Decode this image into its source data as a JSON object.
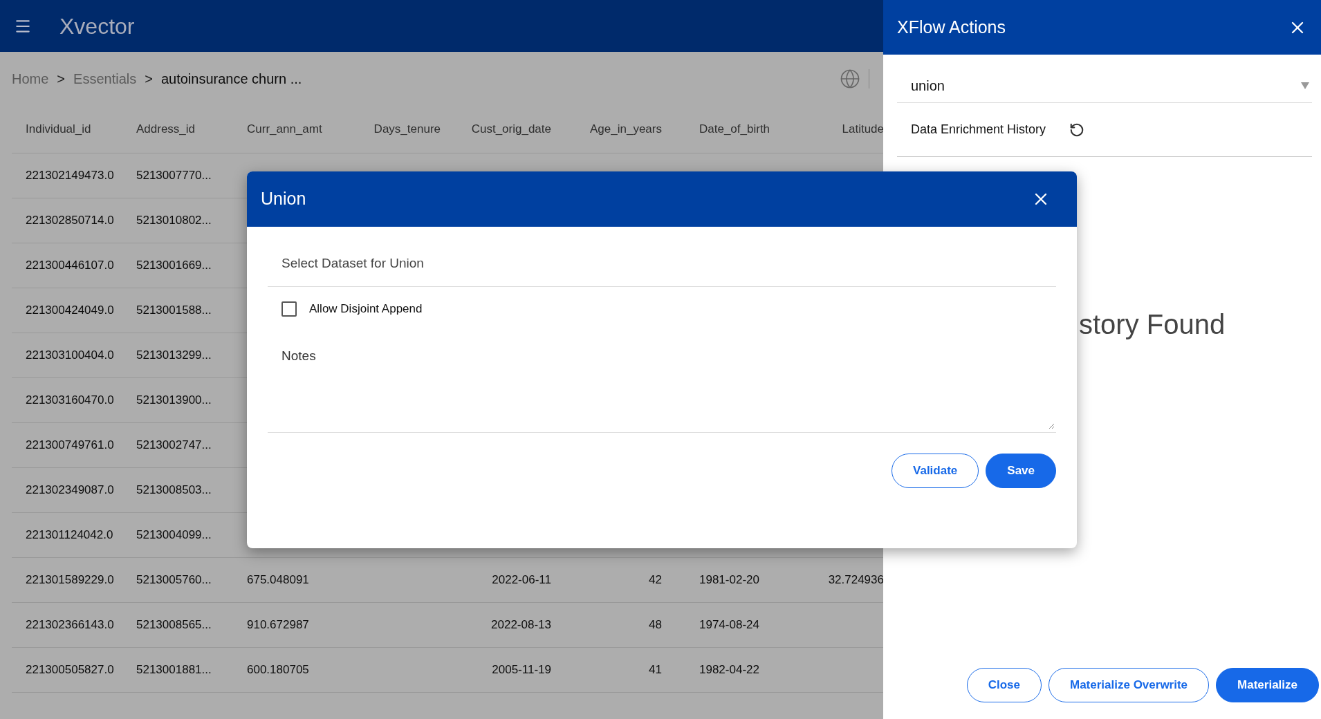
{
  "app": {
    "logo": "Xvector"
  },
  "breadcrumb": [
    {
      "label": "Home",
      "current": false
    },
    {
      "label": "Essentials",
      "current": false
    },
    {
      "label": "autoinsurance churn ...",
      "current": true
    }
  ],
  "breadcrumb_separator": ">",
  "table": {
    "columns": [
      "Individual_id",
      "Address_id",
      "Curr_ann_amt",
      "Days_tenure",
      "Cust_orig_date",
      "Age_in_years",
      "Date_of_birth",
      "Latitude"
    ],
    "rows": [
      {
        "individual_id": "221302149473.0",
        "address_id": "5213007770..."
      },
      {
        "individual_id": "221302850714.0",
        "address_id": "5213010802..."
      },
      {
        "individual_id": "221300446107.0",
        "address_id": "5213001669..."
      },
      {
        "individual_id": "221300424049.0",
        "address_id": "5213001588..."
      },
      {
        "individual_id": "221303100404.0",
        "address_id": "5213013299..."
      },
      {
        "individual_id": "221303160470.0",
        "address_id": "5213013900..."
      },
      {
        "individual_id": "221300749761.0",
        "address_id": "5213002747..."
      },
      {
        "individual_id": "221302349087.0",
        "address_id": "5213008503..."
      },
      {
        "individual_id": "221301124042.0",
        "address_id": "5213004099..."
      },
      {
        "individual_id": "221301589229.0",
        "address_id": "5213005760...",
        "curr_ann_amt": "675.048091",
        "cust_orig_date": "2022-06-11",
        "age_in_years": "42",
        "date_of_birth": "1981-02-20",
        "latitude": "32.724936"
      },
      {
        "individual_id": "221302366143.0",
        "address_id": "5213008565...",
        "curr_ann_amt": "910.672987",
        "cust_orig_date": "2022-08-13",
        "age_in_years": "48",
        "date_of_birth": "1974-08-24"
      },
      {
        "individual_id": "221300505827.0",
        "address_id": "5213001881...",
        "curr_ann_amt": "600.180705",
        "cust_orig_date": "2005-11-19",
        "age_in_years": "41",
        "date_of_birth": "1982-04-22"
      }
    ]
  },
  "panel": {
    "title": "XFlow Actions",
    "action_select": {
      "value": "union"
    },
    "history_label": "Data Enrichment History",
    "empty_message": "story Found",
    "buttons": [
      {
        "label": "Close",
        "primary": false
      },
      {
        "label": "Materialize Overwrite",
        "primary": false
      },
      {
        "label": "Materialize",
        "primary": true
      }
    ]
  },
  "dialog": {
    "title": "Union",
    "dataset_field": {
      "placeholder": "Select Dataset for Union"
    },
    "disjoint_append": {
      "label": "Allow Disjoint Append",
      "checked": false
    },
    "notes": {
      "label": "Notes"
    },
    "buttons": [
      {
        "label": "Validate",
        "primary": false
      },
      {
        "label": "Save",
        "primary": true
      }
    ]
  }
}
